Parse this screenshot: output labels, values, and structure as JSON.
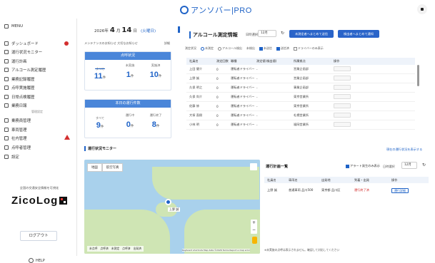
{
  "header": {
    "logo_text": "アンソバー|PRO",
    "user_icon": "user-icon"
  },
  "sidebar": {
    "menu_label": "MENU",
    "items": [
      {
        "label": "ダッシュボード",
        "icon": "dashboard-icon"
      },
      {
        "label": "運行状況モニター",
        "icon": "monitor-icon"
      },
      {
        "label": "運行計画",
        "icon": "plan-icon"
      },
      {
        "label": "アルコール測定履歴",
        "icon": "alcohol-icon"
      },
      {
        "label": "業務記録履歴",
        "icon": "record-icon"
      },
      {
        "label": "点呼実施履歴",
        "icon": "rollcall-icon"
      },
      {
        "label": "日常点検履歴",
        "icon": "inspection-icon"
      },
      {
        "label": "業務日報",
        "icon": "report-icon"
      },
      {
        "label": "乗務員管理",
        "icon": "crew-icon"
      },
      {
        "label": "車両管理",
        "icon": "vehicle-icon"
      },
      {
        "label": "社内管理",
        "icon": "company-icon"
      },
      {
        "label": "点呼者管理",
        "icon": "caller-icon"
      },
      {
        "label": "設定",
        "icon": "settings-icon"
      }
    ],
    "section_label": "管理設定",
    "zico_caption": "全国の交通安全情報を可視化",
    "zico_logo": "ZicoLog",
    "logout_label": "ログアウト",
    "help_label": "HELP"
  },
  "date": {
    "year": "2026年",
    "month": "4",
    "month_unit": "月",
    "day": "14",
    "day_unit": "日",
    "weekday": "(火曜日)"
  },
  "maintenance": {
    "text": "メンテナンスのお知らせ 大切なお知らせ",
    "detail": "詳細"
  },
  "cards": [
    {
      "title": "点呼状況",
      "stats": [
        {
          "label": "すべて",
          "value": "11",
          "unit": "件"
        },
        {
          "label": "未実施",
          "value": "1",
          "unit": "件"
        },
        {
          "label": "実施済",
          "value": "10",
          "unit": "件"
        }
      ]
    },
    {
      "title": "本日の運行件数",
      "stats": [
        {
          "label": "すべて",
          "value": "9",
          "unit": "件"
        },
        {
          "label": "運行中",
          "value": "0",
          "unit": "件"
        },
        {
          "label": "運行終了",
          "value": "8",
          "unit": "件"
        }
      ]
    }
  ],
  "alcohol": {
    "title": "アルコール測定情報",
    "date_label": "日時選択",
    "date_value": "12月",
    "btn1": "未測定者へまとめて送信",
    "btn2": "検出者へまとめて通知",
    "filter": {
      "label1": "測定状況",
      "opt_all": "未測定",
      "opt_alc": "アルコール検出",
      "label2": "未検出",
      "chk1": "未送信",
      "chk2": "送信済",
      "chk3": "ドライバーのみ表示"
    },
    "columns": [
      "社員名",
      "測定回数",
      "職種",
      "測定値(検出値)",
      "所属拠点",
      "操作"
    ],
    "rows": [
      {
        "name": "上田 健介",
        "count": "0",
        "role": "運転者ドライバー",
        "value": "-",
        "dept": "営業企画部"
      },
      {
        "name": "上野 誠",
        "count": "0",
        "role": "運転者ドライバー",
        "value": "-",
        "dept": "営業企画部"
      },
      {
        "name": "久保 明之",
        "count": "0",
        "role": "運転者ドライバー",
        "value": "-",
        "dept": "事業企画部"
      },
      {
        "name": "久保 尚介",
        "count": "0",
        "role": "運転者ドライバー",
        "value": "-",
        "dept": "東京営業所"
      },
      {
        "name": "佐藤 修",
        "count": "0",
        "role": "運転者ドライバー",
        "value": "-",
        "dept": "東京営業所"
      },
      {
        "name": "大塚 直樹",
        "count": "0",
        "role": "運転者ドライバー",
        "value": "-",
        "dept": "札幌営業所"
      },
      {
        "name": "小林 明",
        "count": "0",
        "role": "運転者ドライバー",
        "value": "-",
        "dept": "福岡営業所"
      }
    ]
  },
  "monitor": {
    "title": "運行状況モニター",
    "link": "現在の運行状況を表示する",
    "tabs": [
      "地図",
      "航空写真"
    ],
    "pin_label": "上野 誠",
    "legend": [
      "未点呼",
      "点呼済",
      "未測定",
      "点呼済",
      "出発済"
    ],
    "credit": "Keyboard shortcuts  Map data ©2026  Terms  Report a map error"
  },
  "ops": {
    "title": "運行計画一覧",
    "chk_label": "アラート発生のみ表示",
    "date_label": "日時選択",
    "date_value": "12月",
    "columns": [
      "社員名",
      "車両名",
      "出発地",
      "到着・出発",
      "操作"
    ],
    "row": {
      "name": "上野 誠",
      "vehicle": "普通車両 品川500",
      "origin": "東京都 品川区",
      "status": "運行終了済",
      "detail": "運行詳細"
    },
    "note": "※未実施の点呼は表示されません。確認して対応してください"
  }
}
